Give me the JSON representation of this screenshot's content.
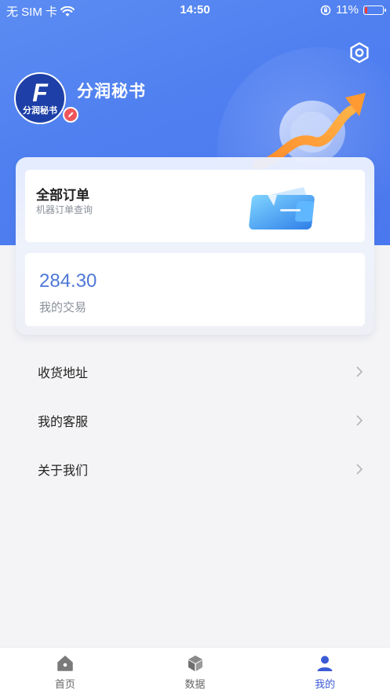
{
  "status_bar": {
    "carrier": "无 SIM 卡",
    "time": "14:50",
    "battery": "11%",
    "battery_level": 0.11
  },
  "profile": {
    "avatar_letter": "F",
    "avatar_text": "分润秘书",
    "name": "分润秘书"
  },
  "orders_card": {
    "title": "全部订单",
    "subtitle": "机器订单查询"
  },
  "trade_card": {
    "amount": "284.30",
    "label": "我的交易"
  },
  "menu": {
    "items": [
      {
        "label": "收货地址"
      },
      {
        "label": "我的客服"
      },
      {
        "label": "关于我们"
      }
    ]
  },
  "tabbar": {
    "tabs": [
      {
        "label": "首页",
        "icon": "home-icon"
      },
      {
        "label": "数据",
        "icon": "cube-icon"
      },
      {
        "label": "我的",
        "icon": "user-icon"
      }
    ],
    "active_index": 2
  },
  "colors": {
    "hero": "#4f7ff0",
    "accent": "#3b5bd6",
    "amount": "#4e78d6",
    "badge": "#f0555a"
  }
}
